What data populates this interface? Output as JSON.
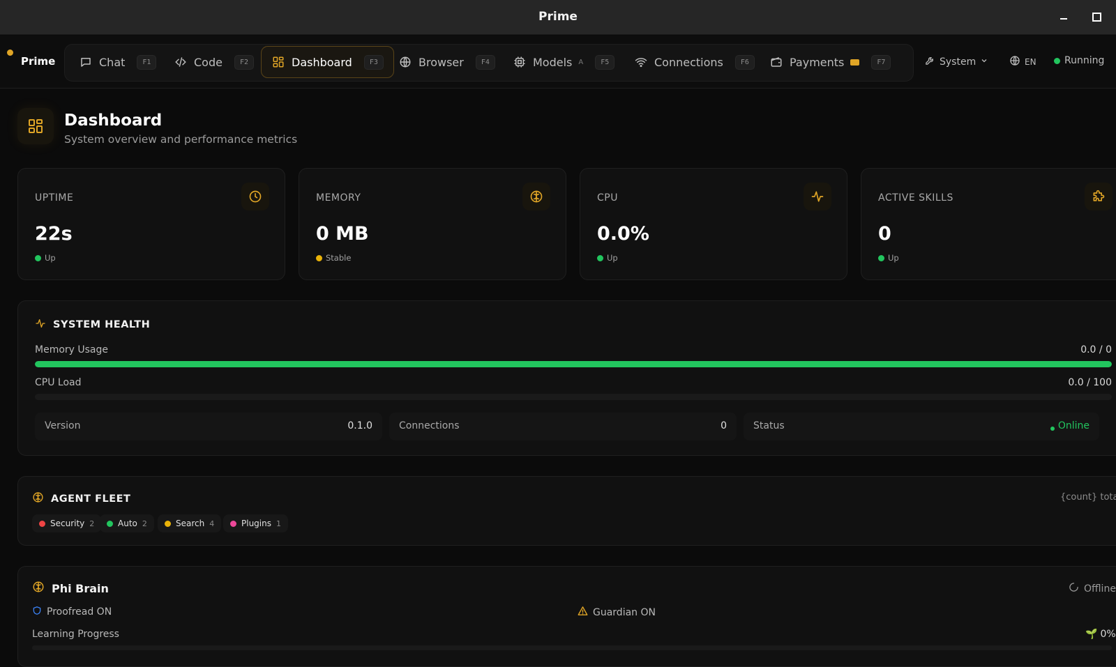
{
  "window": {
    "title": "Prime"
  },
  "nav": {
    "brand": "Prime",
    "tabs": [
      {
        "label": "Chat",
        "shortcut": "F1",
        "icon": "chat-icon"
      },
      {
        "label": "Code",
        "shortcut": "F2",
        "icon": "code-icon"
      },
      {
        "label": "Dashboard",
        "shortcut": "F3",
        "icon": "dashboard-icon",
        "active": true
      },
      {
        "label": "Browser",
        "shortcut": "F4",
        "icon": "globe-icon"
      },
      {
        "label": "Models",
        "sub": "A",
        "shortcut": "F5",
        "icon": "cpu-icon"
      },
      {
        "label": "Connections",
        "shortcut": "F6",
        "icon": "wifi-icon"
      },
      {
        "label": "Payments",
        "shortcut": "F7",
        "icon": "wallet-icon"
      }
    ],
    "system_label": "System",
    "language": "EN",
    "status": "Running"
  },
  "page": {
    "title": "Dashboard",
    "subtitle": "System overview and performance metrics"
  },
  "stats": [
    {
      "label": "UPTIME",
      "value": "22s",
      "status": "Up",
      "status_color": "#22c55e",
      "icon": "clock-icon"
    },
    {
      "label": "MEMORY",
      "value": "0 MB",
      "status": "Stable",
      "status_color": "#eab308",
      "icon": "brain-icon"
    },
    {
      "label": "CPU",
      "value": "0.0%",
      "status": "Up",
      "status_color": "#22c55e",
      "icon": "activity-icon"
    },
    {
      "label": "ACTIVE SKILLS",
      "value": "0",
      "status": "Up",
      "status_color": "#22c55e",
      "icon": "puzzle-icon"
    }
  ],
  "health": {
    "title": "SYSTEM HEALTH",
    "memory_label": "Memory Usage",
    "memory_value": "0.0 / 0",
    "memory_fill": 1.0,
    "cpu_label": "CPU Load",
    "cpu_value": "0.0 / 100",
    "cpu_fill": 0.0,
    "info": [
      {
        "key": "Version",
        "value": "0.1.0"
      },
      {
        "key": "Connections",
        "value": "0"
      },
      {
        "key": "Status",
        "value": "Online"
      }
    ]
  },
  "fleet": {
    "title": "AGENT FLEET",
    "total_label": "{count} total",
    "chips": [
      {
        "label": "Security",
        "count": "2",
        "color": "#ef4444"
      },
      {
        "label": "Auto",
        "count": "2",
        "color": "#22c55e"
      },
      {
        "label": "Search",
        "count": "4",
        "color": "#eab308"
      },
      {
        "label": "Plugins",
        "count": "1",
        "color": "#ec4899"
      }
    ]
  },
  "brain": {
    "title": "Phi Brain",
    "status": "Offline",
    "proofread": "Proofread ON",
    "guardian": "Guardian ON",
    "learning_label": "Learning Progress",
    "learning_value": "0%"
  },
  "colors": {
    "accent": "#e0a526",
    "success": "#22c55e"
  }
}
